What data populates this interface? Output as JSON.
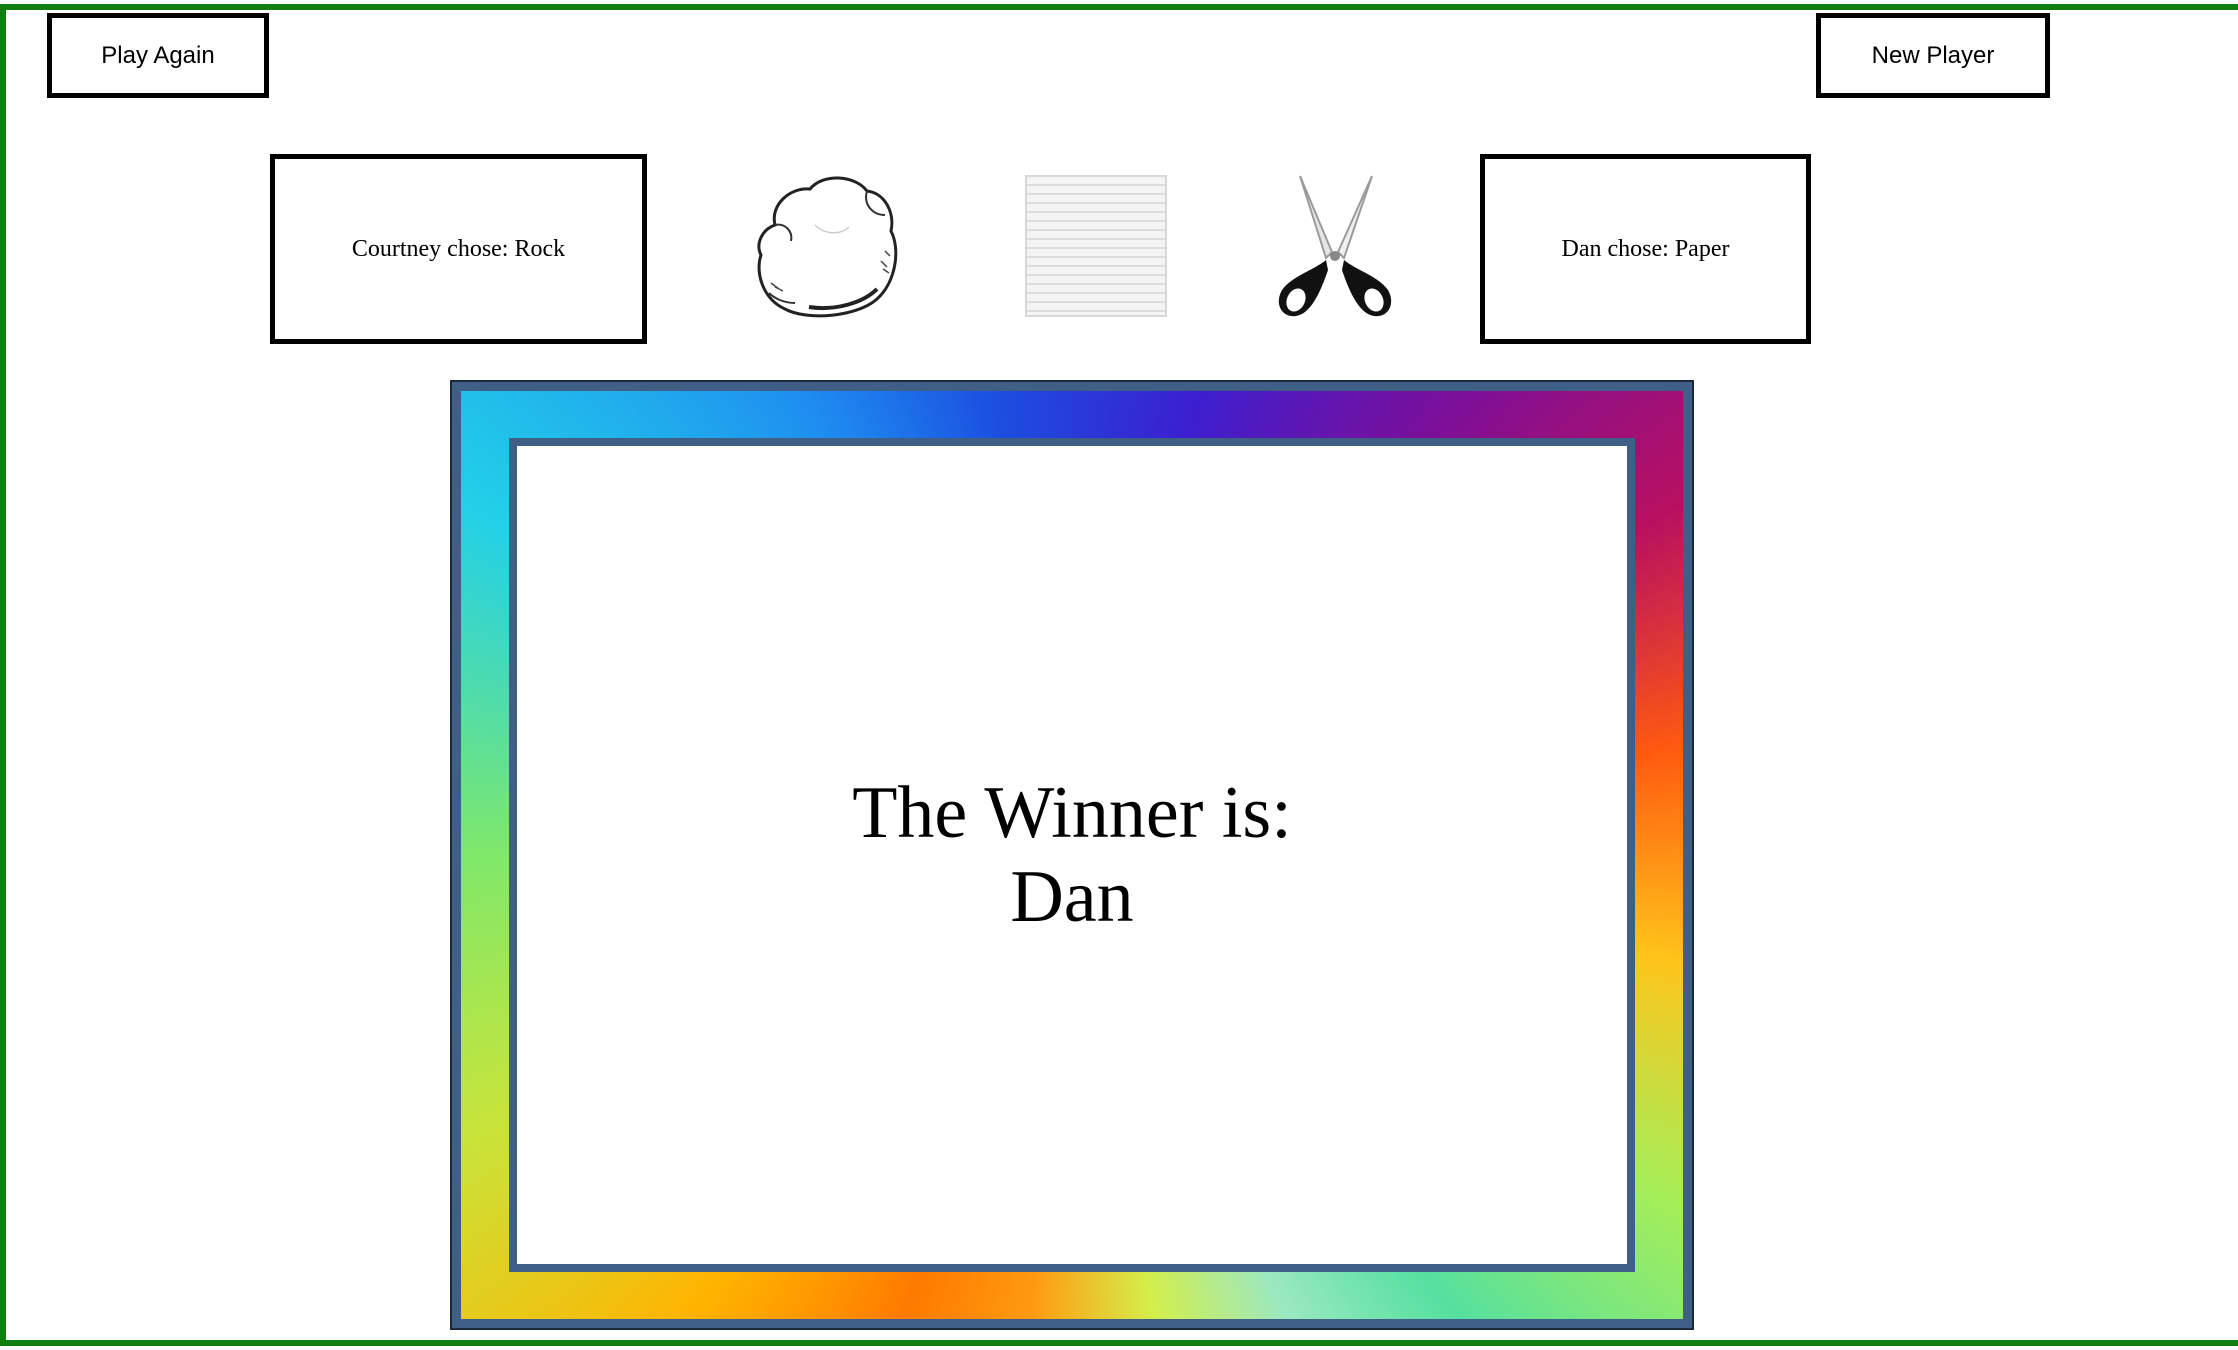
{
  "buttons": {
    "play_again": "Play Again",
    "new_player": "New Player"
  },
  "players": {
    "left_choice_text": "Courtney chose: Rock",
    "right_choice_text": "Dan chose: Paper"
  },
  "weapons": [
    {
      "name": "rock",
      "icon": "rock-icon"
    },
    {
      "name": "paper",
      "icon": "paper-icon"
    },
    {
      "name": "scissors",
      "icon": "scissors-icon"
    }
  ],
  "result": {
    "heading": "The Winner is:",
    "winner": "Dan"
  },
  "colors": {
    "page_border": "#0f7f0f",
    "panel_border": "#3f5f86"
  }
}
